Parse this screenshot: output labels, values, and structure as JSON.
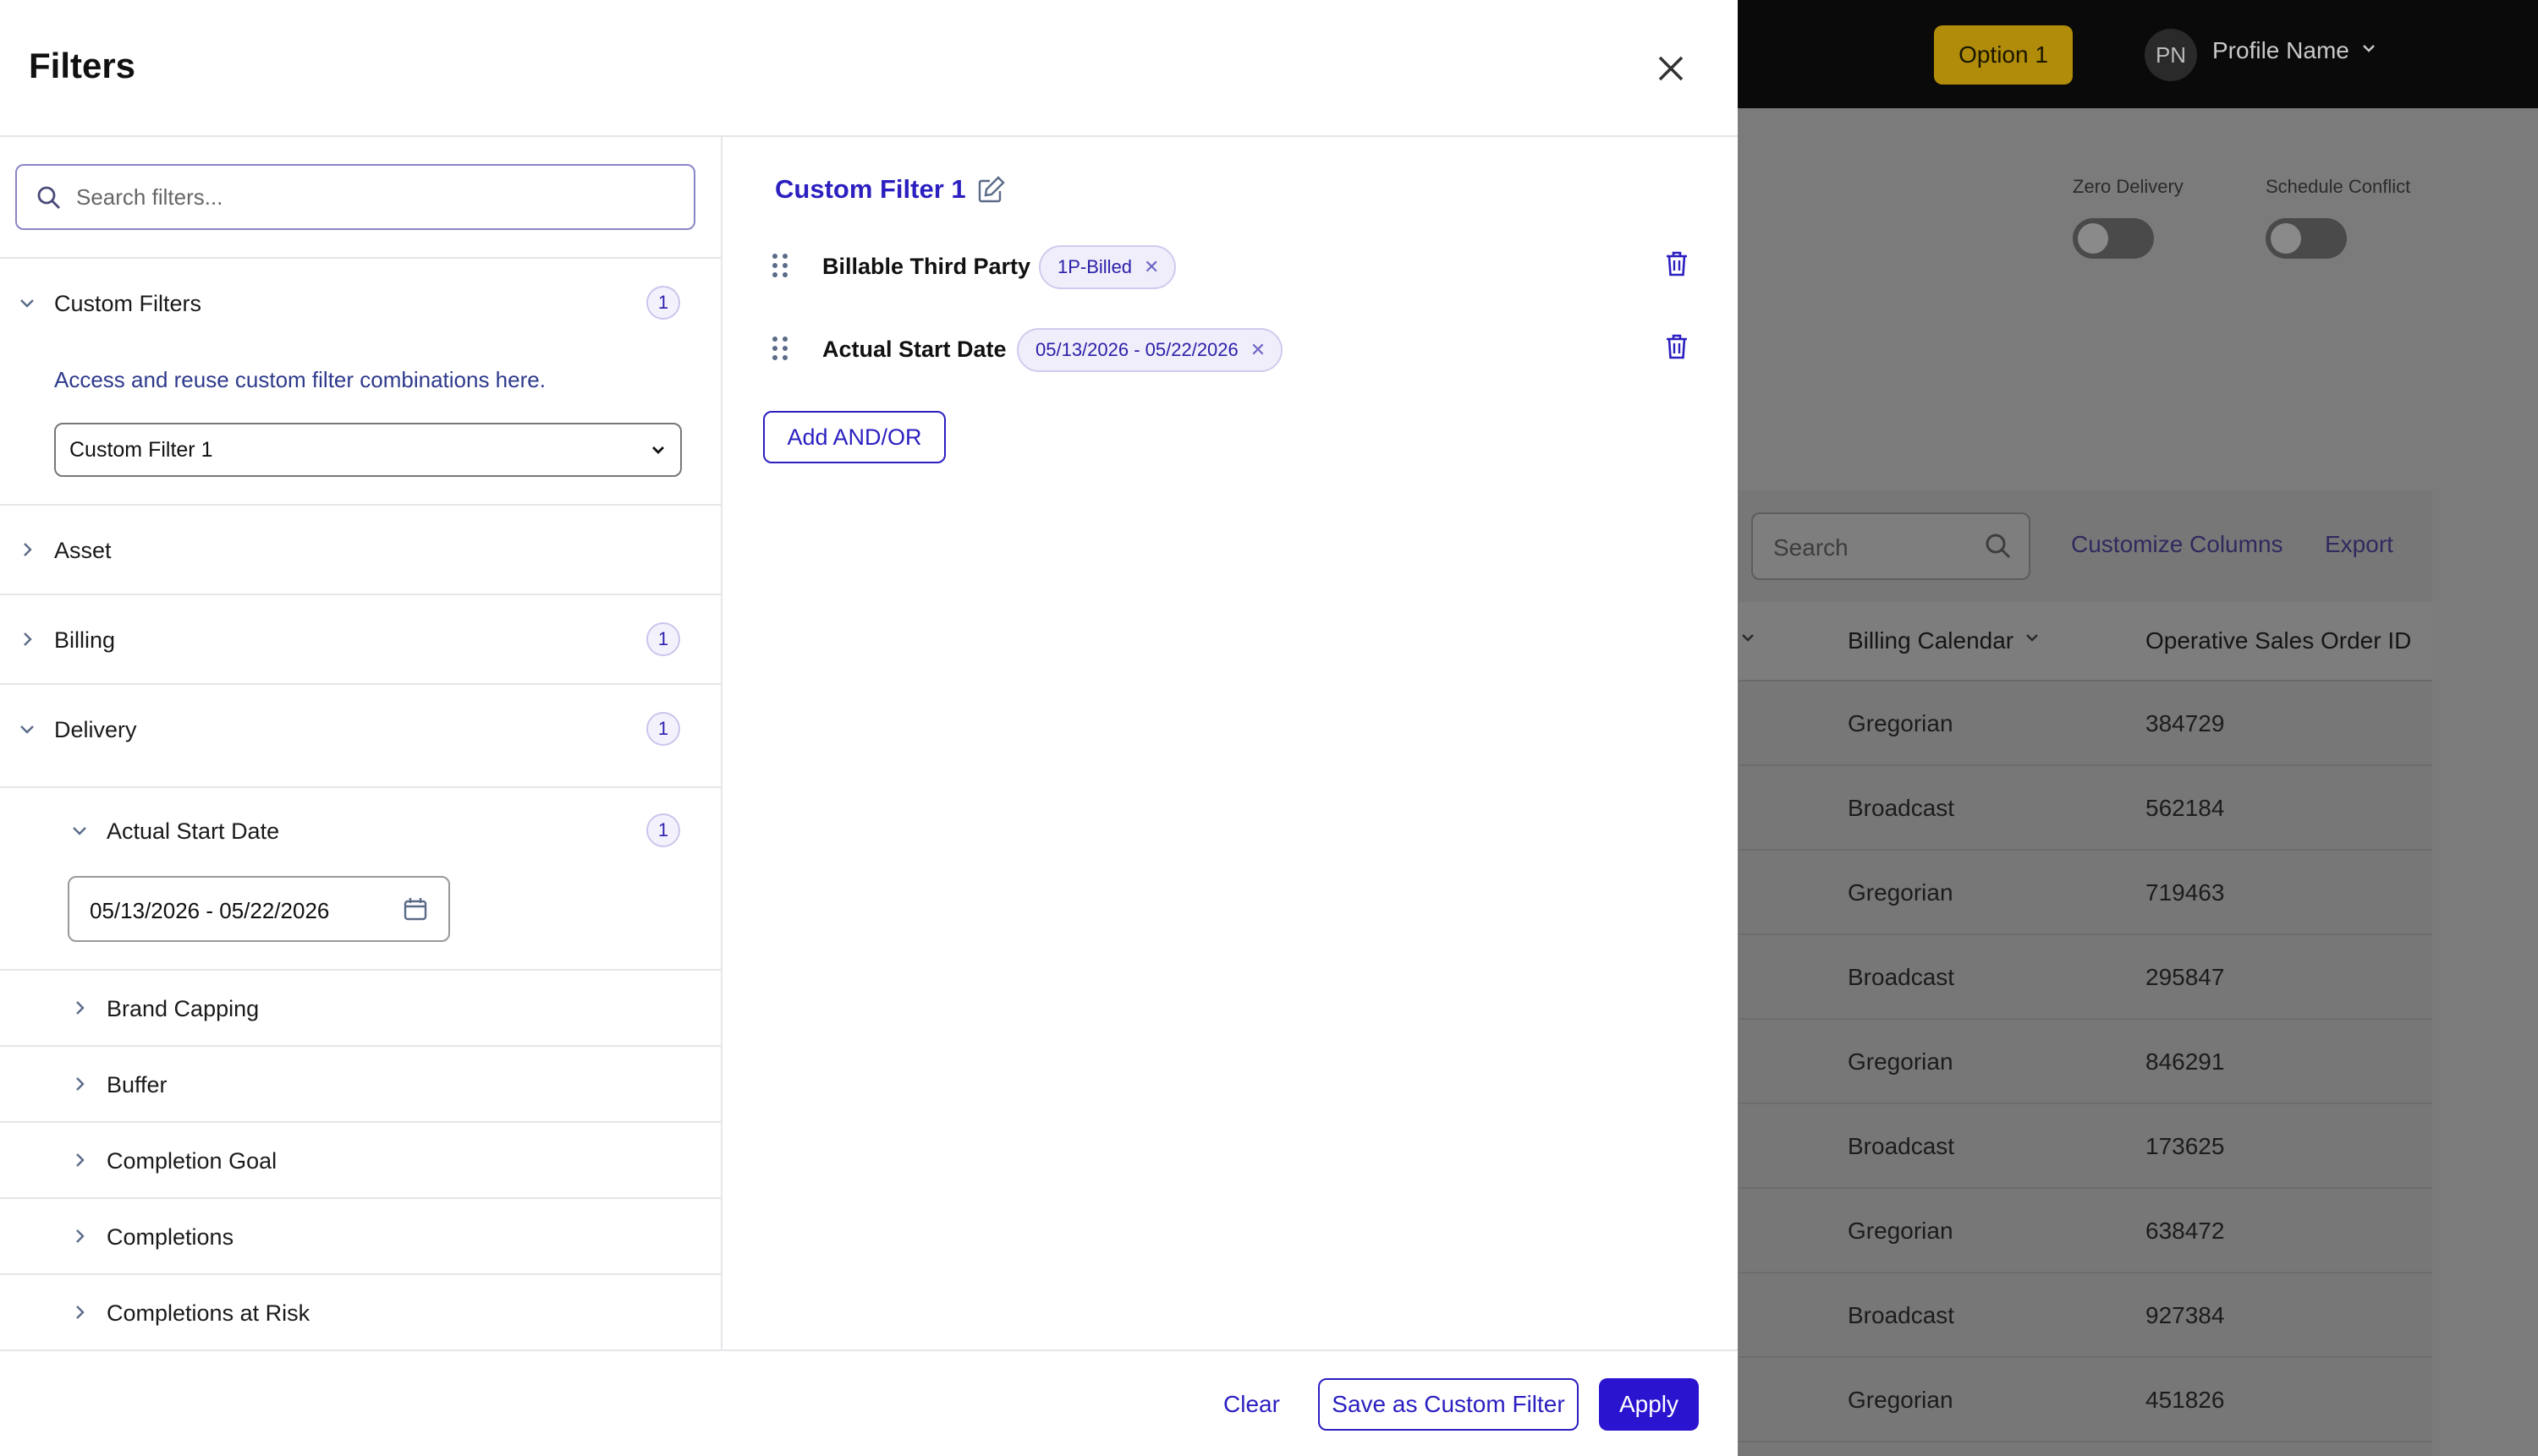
{
  "modal": {
    "title": "Filters",
    "search_placeholder": "Search filters...",
    "sections": {
      "custom_filters": {
        "label": "Custom Filters",
        "count": "1",
        "expanded": true,
        "helper": "Access and reuse custom filter combinations here.",
        "selected": "Custom Filter 1"
      },
      "asset": {
        "label": "Asset",
        "expanded": false
      },
      "billing": {
        "label": "Billing",
        "count": "1",
        "expanded": false
      },
      "delivery": {
        "label": "Delivery",
        "count": "1",
        "expanded": true,
        "children": {
          "actual_start_date": {
            "label": "Actual Start Date",
            "count": "1",
            "value": "05/13/2026 - 05/22/2026"
          },
          "brand_capping": {
            "label": "Brand Capping"
          },
          "buffer": {
            "label": "Buffer"
          },
          "completion_goal": {
            "label": "Completion Goal"
          },
          "completions": {
            "label": "Completions"
          },
          "completions_at_risk": {
            "label": "Completions at Risk"
          }
        }
      }
    },
    "editor": {
      "custom_filter_name": "Custom Filter 1",
      "rules": [
        {
          "label": "Billable Third Party",
          "chip": "1P-Billed"
        },
        {
          "label": "Actual Start Date",
          "chip": "05/13/2026 - 05/22/2026"
        }
      ],
      "add_label": "Add AND/OR"
    },
    "footer": {
      "clear": "Clear",
      "save": "Save as Custom Filter",
      "apply": "Apply"
    }
  },
  "background": {
    "option_button": "Option 1",
    "avatar_initials": "PN",
    "profile_name": "Profile Name",
    "toggles": [
      {
        "label": "Zero Delivery",
        "on": false
      },
      {
        "label": "Schedule Conflict",
        "on": false
      }
    ],
    "search_placeholder": "Search",
    "customize_columns": "Customize Columns",
    "export": "Export",
    "columns": [
      "Billing Calendar",
      "Operative Sales Order ID"
    ],
    "rows": [
      [
        "Gregorian",
        "384729"
      ],
      [
        "Broadcast",
        "562184"
      ],
      [
        "Gregorian",
        "719463"
      ],
      [
        "Broadcast",
        "295847"
      ],
      [
        "Gregorian",
        "846291"
      ],
      [
        "Broadcast",
        "173625"
      ],
      [
        "Gregorian",
        "638472"
      ],
      [
        "Broadcast",
        "927384"
      ],
      [
        "Gregorian",
        "451826"
      ]
    ]
  },
  "colors": {
    "accent": "#2b1fc0",
    "apply_bg": "#2b14d0",
    "option_bg": "#b08c0a"
  }
}
